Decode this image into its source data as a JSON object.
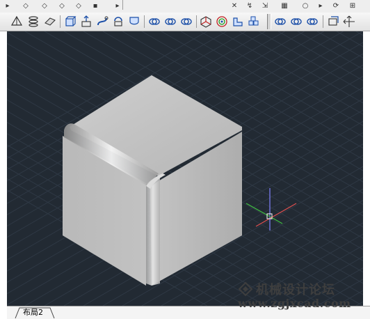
{
  "toolbar": {
    "top_row_icons": [
      "draw-icon",
      "modify-icon",
      "snap-icon",
      "layer-icon",
      "view-icon",
      "dimension-icon",
      "text-icon",
      "zoom-icon",
      "undo-icon",
      "redo-icon",
      "properties-icon"
    ],
    "main_row_icons": [
      "pyramid-icon",
      "helix-icon",
      "planar-surface-icon",
      "extrude-icon",
      "presspull-icon",
      "sweep-icon",
      "revolve-icon",
      "loft-icon",
      "union-icon",
      "subtract-icon",
      "intersect-icon",
      "3d-move-icon",
      "3d-rotate-icon",
      "3d-align-icon",
      "3d-array-icon",
      "interfere-icon",
      "slice-icon",
      "thicken-icon",
      "extract-edges-icon",
      "pan-icon"
    ]
  },
  "viewport": {
    "background_color": "#222a33",
    "grid_color": "#2f3945",
    "solid_color": "#b8b8b8",
    "ucs_colors": {
      "x": "#e05050",
      "y": "#40c040",
      "z": "#8080ff"
    }
  },
  "tabs": {
    "layout_tab_label": "布局2"
  },
  "watermark": {
    "line1": "机械设计论坛",
    "line2": "www.zgjxcad.com"
  }
}
